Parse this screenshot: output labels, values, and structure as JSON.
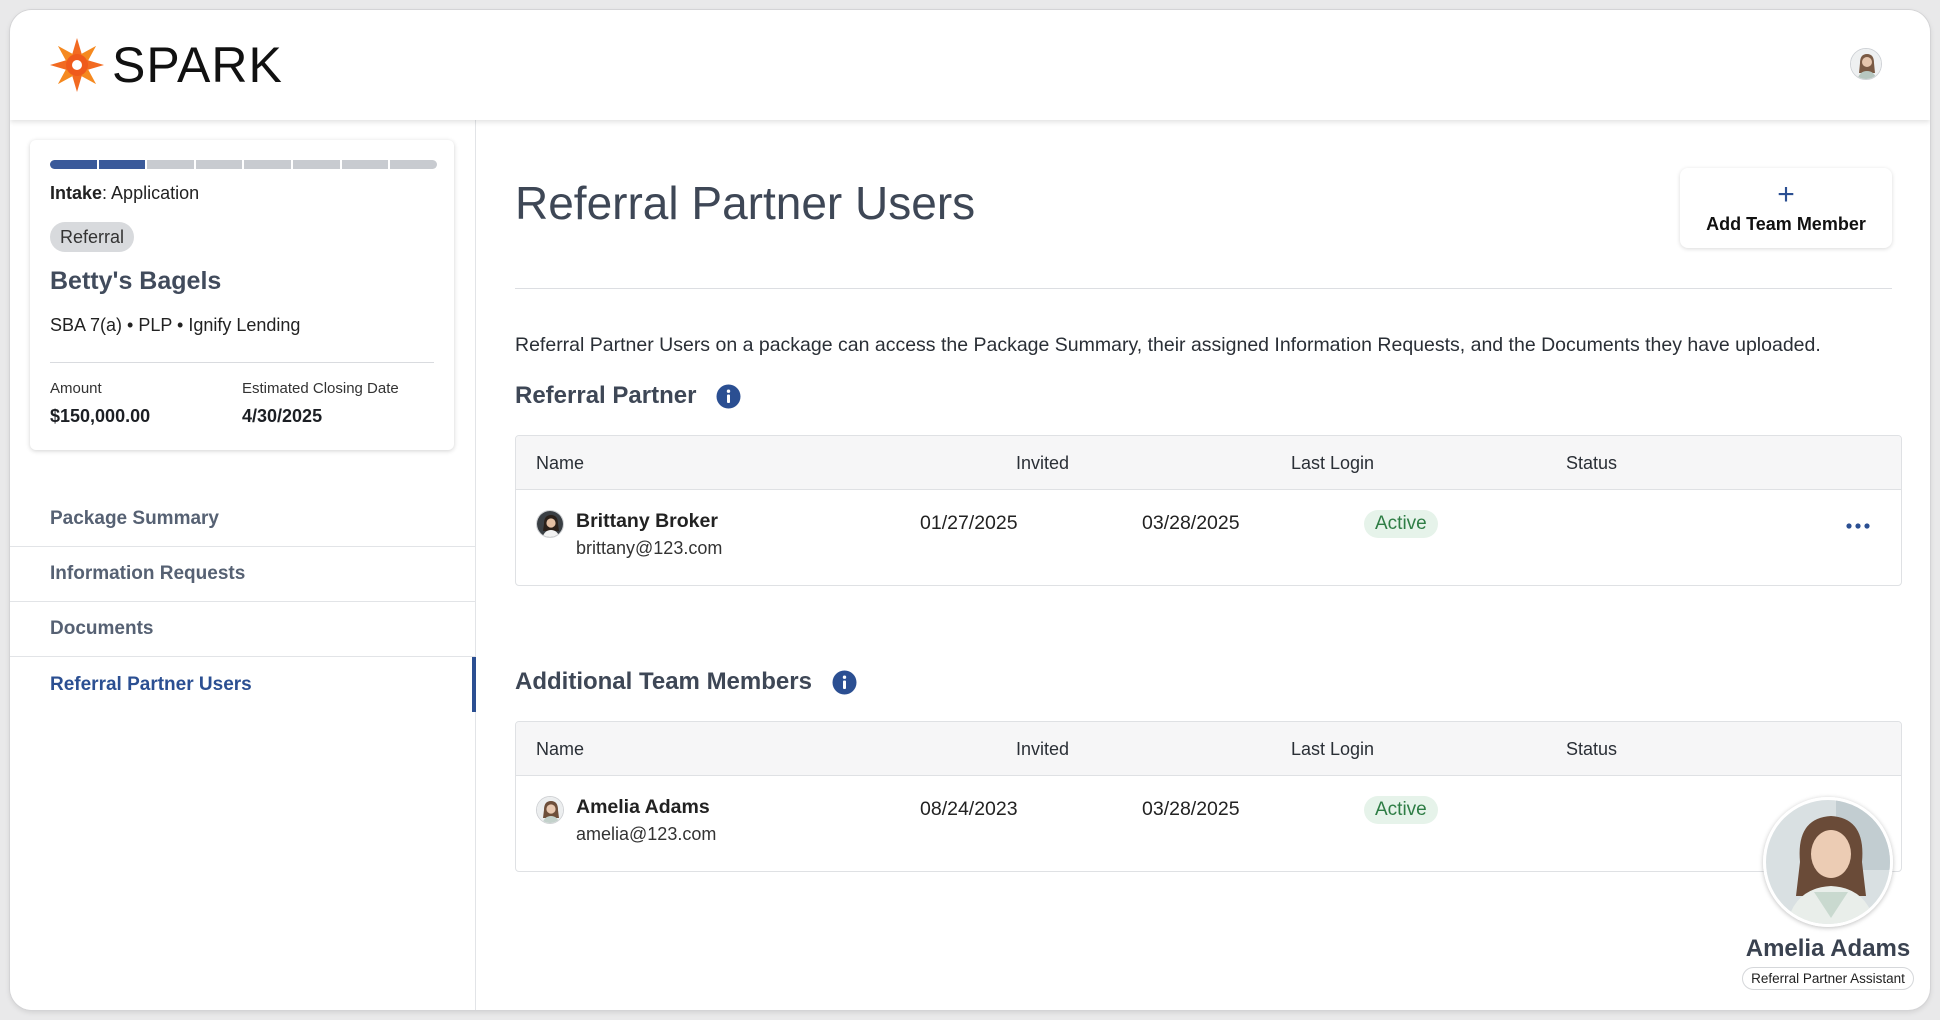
{
  "brand": {
    "name": "SPARK",
    "accent": "#f26a21"
  },
  "header": {
    "avatar_icon": "user-avatar"
  },
  "package_card": {
    "progress": {
      "total_steps": 8,
      "completed_steps": 2,
      "accent": "#3a5a9a"
    },
    "stage_label": "Intake",
    "stage_value": "Application",
    "tag": "Referral",
    "business_name": "Betty's Bagels",
    "meta": "SBA 7(a) • PLP • Ignify Lending",
    "amount_label": "Amount",
    "amount_value": "$150,000.00",
    "closing_label": "Estimated Closing Date",
    "closing_value": "4/30/2025"
  },
  "sidebar": {
    "items": [
      {
        "label": "Package Summary",
        "active": false
      },
      {
        "label": "Information Requests",
        "active": false
      },
      {
        "label": "Documents",
        "active": false
      },
      {
        "label": "Referral Partner Users",
        "active": true
      }
    ]
  },
  "main": {
    "title": "Referral Partner Users",
    "add_button": {
      "icon": "+",
      "label": "Add Team Member"
    },
    "intro": "Referral Partner Users on a package can access the Package Summary, their assigned Information Requests, and the Documents they have uploaded.",
    "columns": {
      "name": "Name",
      "invited": "Invited",
      "last_login": "Last Login",
      "status": "Status"
    },
    "referral_partner": {
      "title": "Referral Partner",
      "rows": [
        {
          "name": "Brittany Broker",
          "email": "brittany@123.com",
          "invited": "01/27/2025",
          "last_login": "03/28/2025",
          "status": "Active"
        }
      ]
    },
    "additional_members": {
      "title": "Additional Team Members",
      "rows": [
        {
          "name": "Amelia Adams",
          "email": "amelia@123.com",
          "invited": "08/24/2023",
          "last_login": "03/28/2025",
          "status": "Active"
        }
      ]
    }
  },
  "assistant": {
    "name": "Amelia Adams",
    "role": "Referral Partner Assistant"
  },
  "colors": {
    "primary": "#2b4f92",
    "active_status_bg": "#e6f3ea",
    "active_status_text": "#2e7d45"
  }
}
